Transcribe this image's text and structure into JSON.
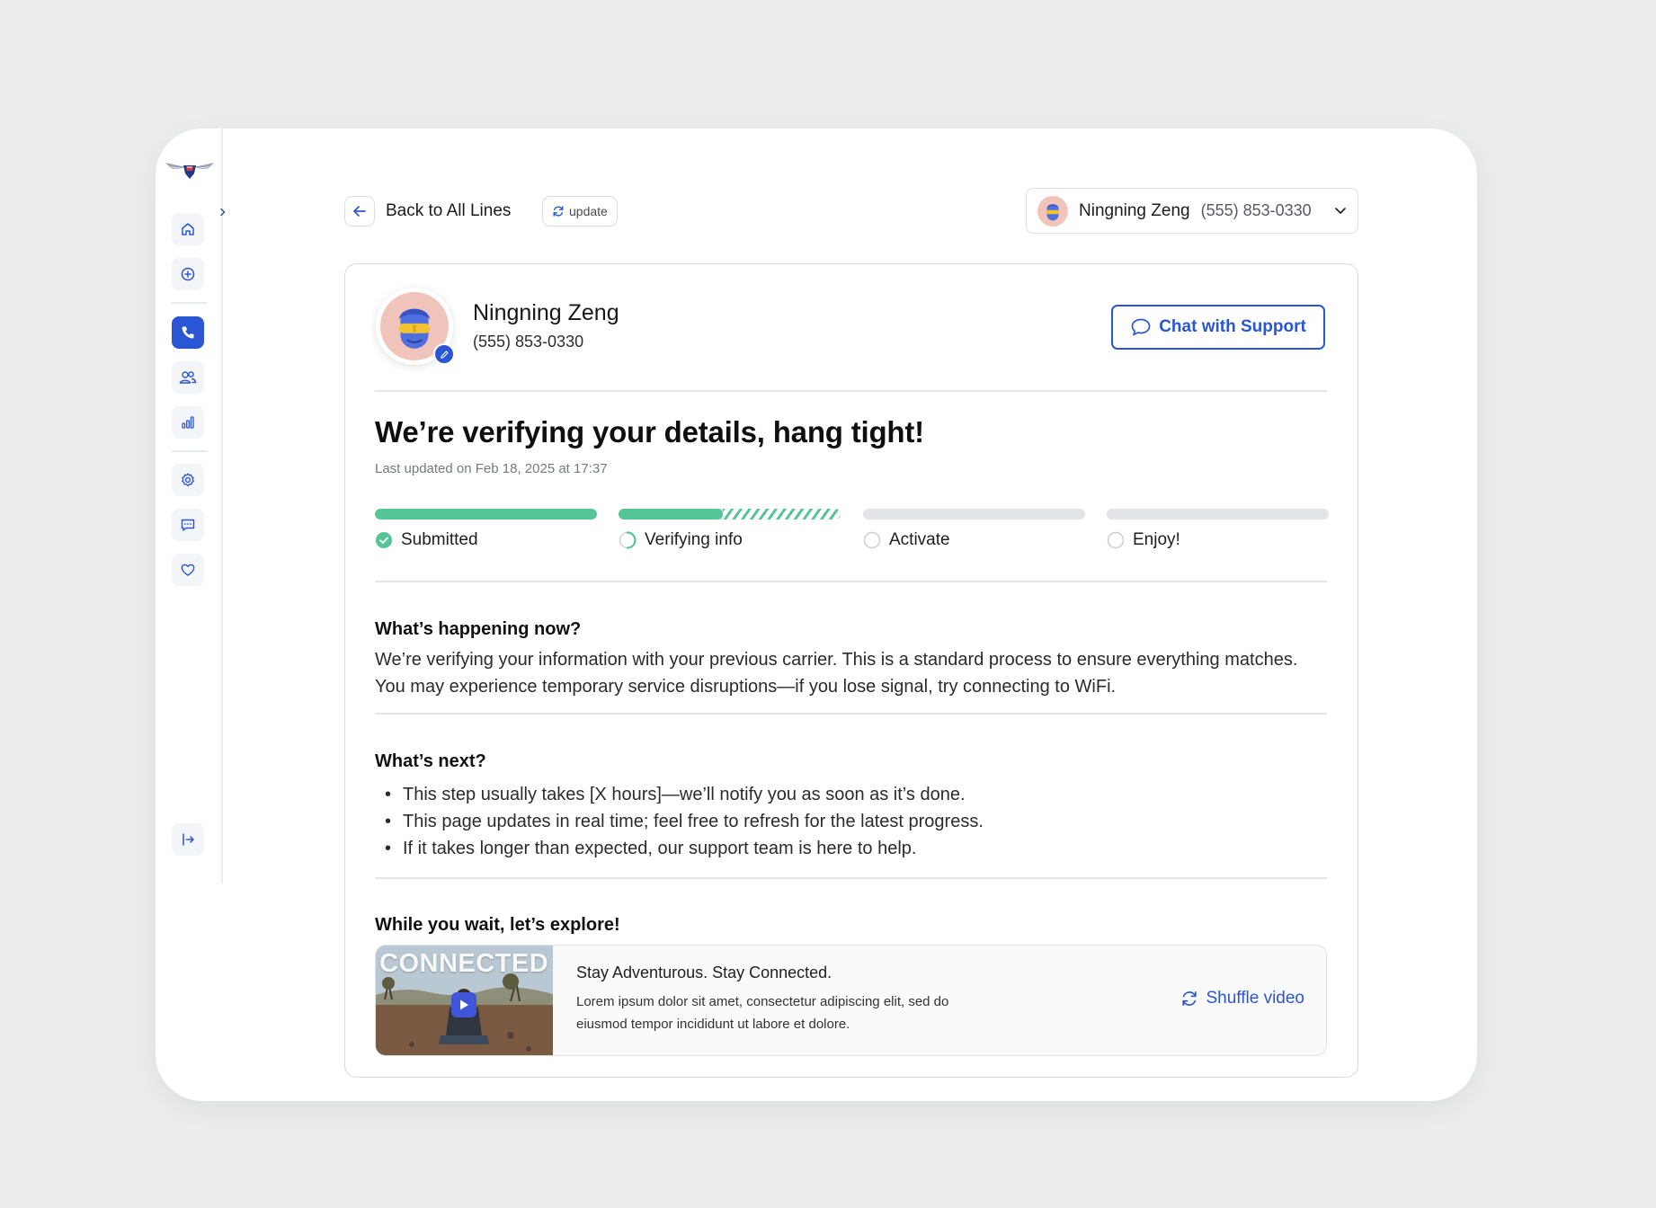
{
  "colors": {
    "accent": "#2a56d6",
    "success": "#55c595",
    "background": "#ebedec"
  },
  "sidebar": {
    "logo": "airline-wings-logo",
    "items": [
      {
        "name": "home-icon",
        "active": false
      },
      {
        "name": "plus-circle-icon",
        "active": false
      },
      {
        "name": "phone-icon",
        "active": true
      },
      {
        "name": "users-icon",
        "active": false
      },
      {
        "name": "bar-chart-icon",
        "active": false
      },
      {
        "name": "settings-icon",
        "active": false
      },
      {
        "name": "chat-icon",
        "active": false
      },
      {
        "name": "heart-icon",
        "active": false
      },
      {
        "name": "logout-icon",
        "active": false
      }
    ]
  },
  "topbar": {
    "back_label": "Back to All Lines",
    "update_label": "update",
    "line_selector": {
      "name": "Ningning Zeng",
      "phone": "(555) 853-0330"
    }
  },
  "profile": {
    "name": "Ningning Zeng",
    "phone": "(555) 853-0330"
  },
  "chat_button": "Chat with Support",
  "status": {
    "headline": "We’re verifying your details, hang tight!",
    "last_updated": "Last updated on Feb 18, 2025 at 17:37",
    "steps": [
      {
        "label": "Submitted",
        "state": "complete",
        "progress": 1.0
      },
      {
        "label": "Verifying info",
        "state": "in-progress",
        "progress": 0.47
      },
      {
        "label": "Activate",
        "state": "pending",
        "progress": 0
      },
      {
        "label": "Enjoy!",
        "state": "pending",
        "progress": 0
      }
    ]
  },
  "now": {
    "title": "What’s happening now?",
    "body": "We’re verifying your information with your previous carrier. This is a standard process to ensure everything matches. You may experience temporary service disruptions—if you lose signal, try connecting to WiFi."
  },
  "next": {
    "title": "What’s next?",
    "items": [
      "This step usually takes [X hours]—we’ll notify you as soon as it’s done.",
      "This page updates in real time; feel free to refresh for the latest progress.",
      "If it takes longer than expected, our support team is here to help."
    ]
  },
  "explore": {
    "title": "While you wait, let’s explore!",
    "video": {
      "thumb_text": "CONNECTED",
      "title": "Stay Adventurous. Stay Connected.",
      "description": "Lorem ipsum dolor sit amet, consectetur adipiscing elit, sed do eiusmod tempor incididunt ut labore et dolore.",
      "shuffle_label": "Shuffle video"
    }
  }
}
